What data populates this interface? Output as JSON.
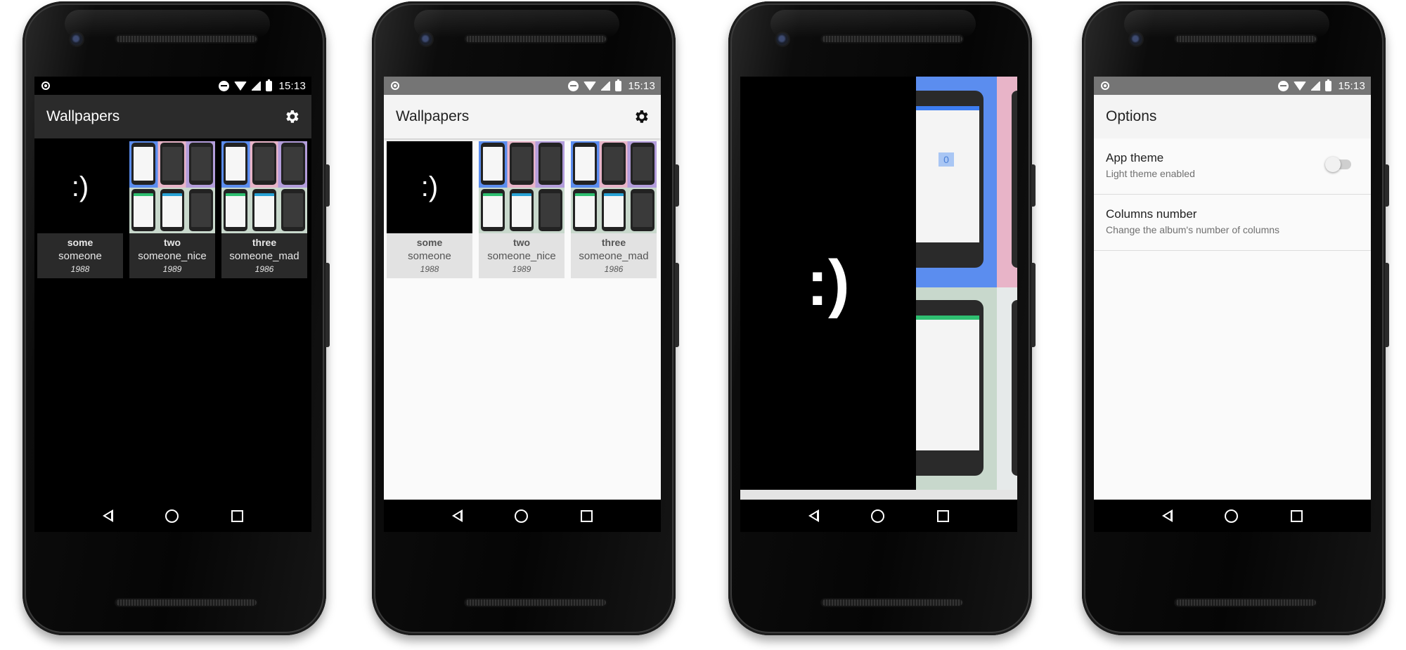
{
  "status_bar": {
    "time": "15:13"
  },
  "gallery": {
    "title": "Wallpapers",
    "albums": [
      {
        "name": "some",
        "artist": "someone",
        "year": "1988",
        "thumb": ":)"
      },
      {
        "name": "two",
        "artist": "someone_nice",
        "year": "1989"
      },
      {
        "name": "three",
        "artist": "someone_mad",
        "year": "1986"
      }
    ]
  },
  "preview": {
    "face": ":)",
    "zoomed_value": "0",
    "actions": [
      "download-icon",
      "check-icon",
      "back-arrow-icon"
    ]
  },
  "options": {
    "title": "Options",
    "items": [
      {
        "title": "App theme",
        "subtitle": "Light theme enabled",
        "toggle": false
      },
      {
        "title": "Columns number",
        "subtitle": "Change the album's number of columns"
      }
    ]
  },
  "colors": {
    "dark_appbar": "#2b2b2b",
    "light_appbar": "#f4f4f4",
    "grey_statusbar": "#757575",
    "blue_wallpaper": "#5b8def",
    "pink_wallpaper": "#e8b4c8",
    "purple_wallpaper": "#b39ddb",
    "green_wallpaper": "#c8d8cc"
  }
}
